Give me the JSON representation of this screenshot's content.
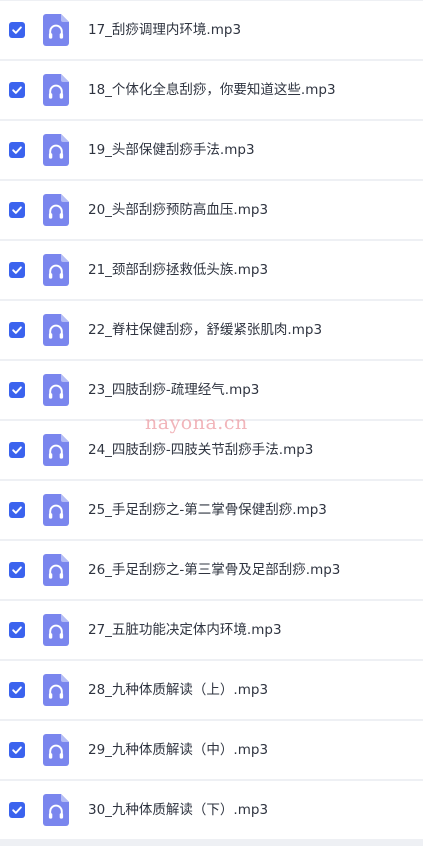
{
  "colors": {
    "checkbox": "#3b63ee",
    "file_icon": "#7a86ee",
    "file_icon_fold": "#b5bdf5",
    "row_bg": "#ffffff",
    "gap_bg": "#eef0f4",
    "text": "#2f3440",
    "watermark": "#e87882"
  },
  "icons": {
    "checkbox": "checkmark-icon",
    "file": "audio-file-headphones-icon"
  },
  "files": [
    {
      "name": "17_刮痧调理内环境.mp3",
      "checked": true
    },
    {
      "name": "18_个体化全息刮痧，你要知道这些.mp3",
      "checked": true
    },
    {
      "name": "19_头部保健刮痧手法.mp3",
      "checked": true
    },
    {
      "name": "20_头部刮痧预防高血压.mp3",
      "checked": true
    },
    {
      "name": "21_颈部刮痧拯救低头族.mp3",
      "checked": true
    },
    {
      "name": "22_脊柱保健刮痧，舒缓紧张肌肉.mp3",
      "checked": true
    },
    {
      "name": "23_四肢刮痧-疏理经气.mp3",
      "checked": true
    },
    {
      "name": "24_四肢刮痧-四肢关节刮痧手法.mp3",
      "checked": true
    },
    {
      "name": "25_手足刮痧之-第二掌骨保健刮痧.mp3",
      "checked": true
    },
    {
      "name": "26_手足刮痧之-第三掌骨及足部刮痧.mp3",
      "checked": true
    },
    {
      "name": "27_五脏功能决定体内环境.mp3",
      "checked": true
    },
    {
      "name": "28_九种体质解读（上）.mp3",
      "checked": true
    },
    {
      "name": "29_九种体质解读（中）.mp3",
      "checked": true
    },
    {
      "name": "30_九种体质解读（下）.mp3",
      "checked": true
    }
  ],
  "watermark": "nayona.cn"
}
